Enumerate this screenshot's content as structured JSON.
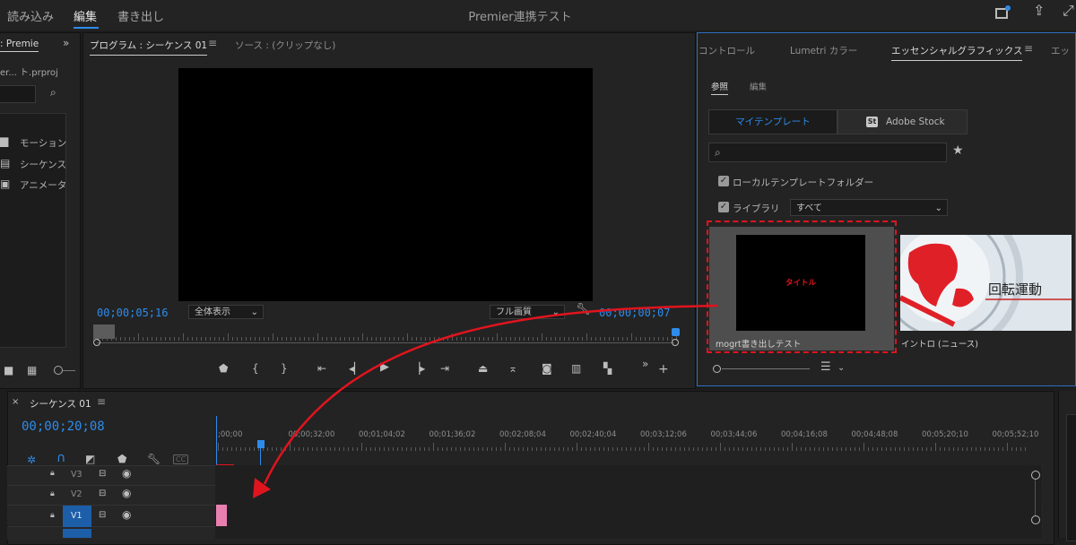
{
  "workspace_tabs": [
    "読み込み",
    "編集",
    "書き出し"
  ],
  "app_title": "Premier連携テスト",
  "project_panel": {
    "tab_label": ": Premie",
    "path": "er... ト.prproj",
    "items": [
      "モーション",
      "シーケンス",
      "アニメータ"
    ]
  },
  "program_monitor": {
    "tab_program": "プログラム : シーケンス 01",
    "tab_source": "ソース : (クリップなし)",
    "current_timecode": "00;00;05;16",
    "zoom_select": "全体表示",
    "quality_select": "フル画質",
    "duration_timecode": "00;00;00;07"
  },
  "right_panel": {
    "tabs": [
      "コントロール",
      "Lumetri カラー",
      "エッセンシャルグラフィックス",
      "エッ"
    ],
    "subtabs": [
      "参照",
      "編集"
    ],
    "toggle_my_templates": "マイテンプレート",
    "toggle_adobe_stock": "Adobe Stock",
    "stock_badge": "St",
    "search_placeholder": "",
    "checkbox_local": "ローカルテンプレートフォルダー",
    "checkbox_library": "ライブラリ",
    "library_select": "すべて",
    "templates": [
      {
        "name": "mogrt書き出しテスト",
        "preview_text": "タイトル"
      },
      {
        "name": "イントロ (ニュース)",
        "preview_text": "回転運動"
      }
    ]
  },
  "timeline": {
    "tab_label": "シーケンス 01",
    "current_timecode": "00;00;20;08",
    "ruler_labels": [
      ";00;00",
      "00;00;32;00",
      "00;01;04;02",
      "00;01;36;02",
      "00;02;08;04",
      "00;02;40;04",
      "00;03;12;06",
      "00;03;44;06",
      "00;04;16;08",
      "00;04;48;08",
      "00;05;20;10",
      "00;05;52;10"
    ],
    "tracks": [
      "V3",
      "V2",
      "V1"
    ],
    "cc_label": "CC"
  },
  "colors": {
    "accent_blue": "#2d8ceb",
    "annotation_red": "#e0141e",
    "clip_pink": "#e97fb0"
  }
}
